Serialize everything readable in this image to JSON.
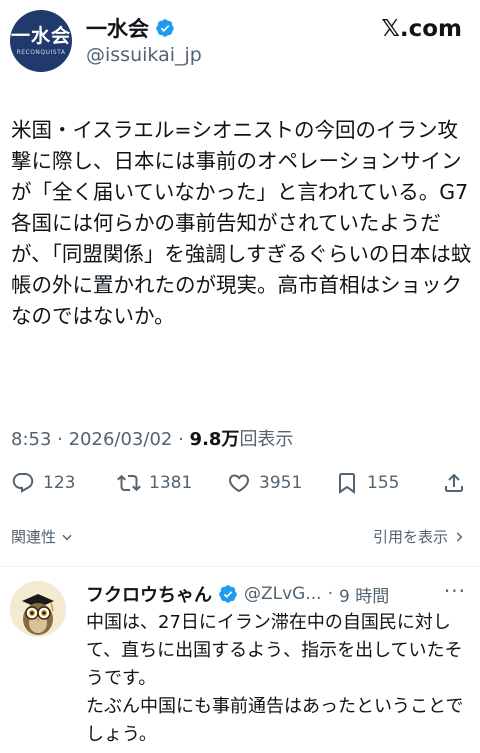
{
  "post": {
    "avatar": {
      "text": "一水会",
      "subtext": "RECONQUISTA",
      "bg": "#1f3a6b"
    },
    "author_name": "一水会",
    "author_handle": "@issuikai_jp",
    "platform_logo": "𝕏.com",
    "text": "米国・イスラエル=シオニストの今回のイラン攻撃に際し、日本には事前のオペレーションサインが「全く届いていなかった」と言われている。G7各国には何らかの事前告知がされていたようだが、「同盟関係」を強調しすぎるぐらいの日本は蚊帳の外に置かれたのが現実。高市首相はショックなのではないか。",
    "time": "8:53",
    "date": "2026/03/02",
    "views_count": "9.8万",
    "views_label": "回表示",
    "actions": {
      "replies": "123",
      "reposts": "1381",
      "likes": "3951",
      "bookmarks": "155"
    },
    "related_label": "関連性",
    "quote_label": "引用を表示"
  },
  "reply": {
    "author_name": "フクロウちゃん",
    "author_handle": "@ZLvG...",
    "time": "9 時間",
    "text": "中国は、27日にイラン滞在中の自国民に対して、直ちに出国するよう、指示を出していたそうです。\nたぶん中国にも事前通告はあったということでしょう。"
  },
  "colors": {
    "verified": "#1d9bf0",
    "text": "#0f1419",
    "secondary": "#536471"
  },
  "icons": [
    "verified-badge-icon",
    "x-logo",
    "reply-icon",
    "repost-icon",
    "like-icon",
    "bookmark-icon",
    "share-icon",
    "chevron-down-icon",
    "chevron-right-icon",
    "more-icon"
  ]
}
